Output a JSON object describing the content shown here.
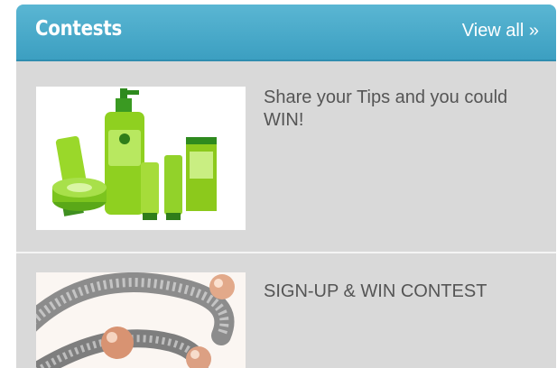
{
  "widget": {
    "title": "Contests",
    "view_all": "View all »"
  },
  "contests": [
    {
      "text": "Share your Tips and you could WIN!",
      "image": "skincare-products-image"
    },
    {
      "text": "SIGN-UP & WIN CONTEST",
      "image": "magnetic-bracelet-image"
    }
  ],
  "colors": {
    "header": "#4aaccb",
    "panel": "#d9d9d9",
    "text": "#555555"
  }
}
